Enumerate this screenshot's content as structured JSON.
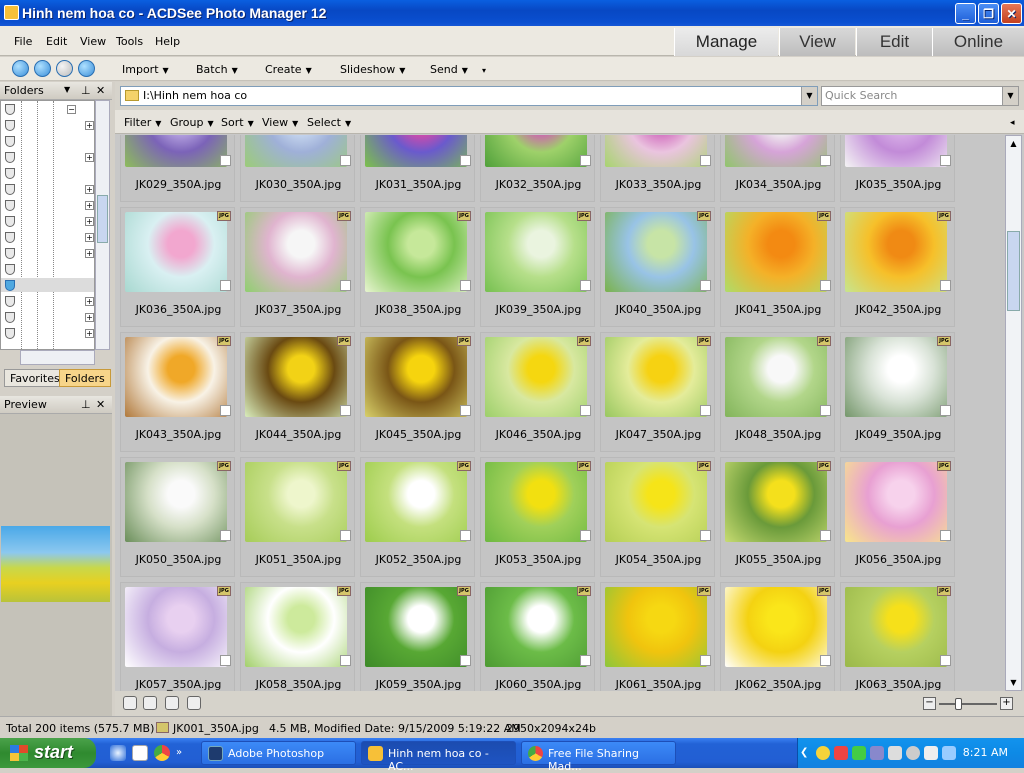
{
  "window": {
    "title": "Hinh nem hoa co - ACDSee Photo Manager 12"
  },
  "menus": [
    "File",
    "Edit",
    "View",
    "Tools",
    "Help"
  ],
  "mode_tabs": [
    "Manage",
    "View",
    "Edit",
    "Online"
  ],
  "toolbar": [
    "Import",
    "Batch",
    "Create",
    "Slideshow",
    "Send"
  ],
  "left_panel": {
    "folders_title": "Folders",
    "favorites_tab": "Favorites",
    "folders_tab": "Folders",
    "preview_title": "Preview"
  },
  "address": {
    "path": "I:\\Hinh nem hoa co",
    "search_placeholder": "Quick Search"
  },
  "filterbar": [
    "Filter",
    "Group",
    "Sort",
    "View",
    "Select"
  ],
  "thumbnails": [
    {
      "name": "JK029_350A.jpg",
      "colors": [
        "#b9a6e3",
        "#7b63b8",
        "#8dbd5a"
      ]
    },
    {
      "name": "JK030_350A.jpg",
      "colors": [
        "#c8d8f0",
        "#9fb0d8",
        "#9ccc78"
      ]
    },
    {
      "name": "JK031_350A.jpg",
      "colors": [
        "#d84aa8",
        "#6a5acd",
        "#7cc24a"
      ]
    },
    {
      "name": "JK032_350A.jpg",
      "colors": [
        "#cf5fb3",
        "#9ed16a",
        "#4fa03a"
      ]
    },
    {
      "name": "JK033_350A.jpg",
      "colors": [
        "#d26fbf",
        "#eac4df",
        "#a7d46e"
      ]
    },
    {
      "name": "JK034_350A.jpg",
      "colors": [
        "#f2f2f2",
        "#d6a4d8",
        "#90c56b"
      ]
    },
    {
      "name": "JK035_350A.jpg",
      "colors": [
        "#d9b0e8",
        "#c28bd8",
        "#f4f4f4"
      ]
    },
    {
      "name": "JK036_350A.jpg",
      "colors": [
        "#f2a7cf",
        "#d9f0f2",
        "#a8d8d0"
      ]
    },
    {
      "name": "JK037_350A.jpg",
      "colors": [
        "#f6f6f6",
        "#e0b4cf",
        "#8fcf6e"
      ]
    },
    {
      "name": "JK038_350A.jpg",
      "colors": [
        "#c6e89a",
        "#79c34f",
        "#e8f5d0"
      ]
    },
    {
      "name": "JK039_350A.jpg",
      "colors": [
        "#eaf4df",
        "#b6df8a",
        "#76c050"
      ]
    },
    {
      "name": "JK040_350A.jpg",
      "colors": [
        "#c7e4a6",
        "#98c3e6",
        "#7ab24c"
      ]
    },
    {
      "name": "JK041_350A.jpg",
      "colors": [
        "#f38a12",
        "#f4b128",
        "#aedc6a"
      ]
    },
    {
      "name": "JK042_350A.jpg",
      "colors": [
        "#f08a14",
        "#f6c02a",
        "#c7e58e"
      ]
    },
    {
      "name": "JK043_350A.jpg",
      "colors": [
        "#f0a828",
        "#f8f2e6",
        "#b0783a"
      ]
    },
    {
      "name": "JK044_350A.jpg",
      "colors": [
        "#f2d216",
        "#6a4a12",
        "#d9eebe"
      ]
    },
    {
      "name": "JK045_350A.jpg",
      "colors": [
        "#f6d40e",
        "#7a5616",
        "#d8d06a"
      ]
    },
    {
      "name": "JK046_350A.jpg",
      "colors": [
        "#f5d710",
        "#d8e8a0",
        "#9ccf6a"
      ]
    },
    {
      "name": "JK047_350A.jpg",
      "colors": [
        "#f6d212",
        "#e4ec9a",
        "#98c760"
      ]
    },
    {
      "name": "JK048_350A.jpg",
      "colors": [
        "#f8f8f8",
        "#b2d68a",
        "#82b45a"
      ]
    },
    {
      "name": "JK049_350A.jpg",
      "colors": [
        "#ffffff",
        "#d8e2d6",
        "#74966a"
      ]
    },
    {
      "name": "JK050_350A.jpg",
      "colors": [
        "#fafafa",
        "#d6e0c8",
        "#6a8e5a"
      ]
    },
    {
      "name": "JK051_350A.jpg",
      "colors": [
        "#eef6cc",
        "#c8e08a",
        "#a6cc58"
      ]
    },
    {
      "name": "JK052_350A.jpg",
      "colors": [
        "#ffffff",
        "#c4e07e",
        "#9dcc4c"
      ]
    },
    {
      "name": "JK053_350A.jpg",
      "colors": [
        "#f2e010",
        "#a0d05a",
        "#6cb840"
      ]
    },
    {
      "name": "JK054_350A.jpg",
      "colors": [
        "#f6e418",
        "#d6e474",
        "#b4ce54"
      ]
    },
    {
      "name": "JK055_350A.jpg",
      "colors": [
        "#f4e01c",
        "#6a9a3a",
        "#c8dc72"
      ]
    },
    {
      "name": "JK056_350A.jpg",
      "colors": [
        "#f7d2ec",
        "#e8a0d2",
        "#f8e68a"
      ]
    },
    {
      "name": "JK057_350A.jpg",
      "colors": [
        "#e8d0f0",
        "#c6aee0",
        "#ffffff"
      ]
    },
    {
      "name": "JK058_350A.jpg",
      "colors": [
        "#cdea9c",
        "#ffffff",
        "#a2d06a"
      ]
    },
    {
      "name": "JK059_350A.jpg",
      "colors": [
        "#ffffff",
        "#58a834",
        "#3d8a28"
      ]
    },
    {
      "name": "JK060_350A.jpg",
      "colors": [
        "#ffffff",
        "#6cbc48",
        "#4c9a32"
      ]
    },
    {
      "name": "JK061_350A.jpg",
      "colors": [
        "#f6d812",
        "#f0c40e",
        "#8cc63c"
      ]
    },
    {
      "name": "JK062_350A.jpg",
      "colors": [
        "#fae61a",
        "#f4d212",
        "#ffffff"
      ]
    },
    {
      "name": "JK063_350A.jpg",
      "colors": [
        "#f6e01a",
        "#b6d060",
        "#9ab84a"
      ]
    }
  ],
  "status": {
    "total": "Total 200 items  (575.7 MB)",
    "file": "JK001_350A.jpg",
    "info": "4.5 MB, Modified Date: 9/15/2009 5:19:22 AM",
    "dims": "2950x2094x24b"
  },
  "taskbar": {
    "start": "start",
    "tasks": [
      "Adobe Photoshop",
      "Hinh nem hoa co - AC...",
      "Free File Sharing Mad..."
    ],
    "clock": "8:21 AM"
  },
  "colors": {
    "title_blue": "#0a4fd0",
    "taskbar_blue": "#2262d6",
    "start_green": "#3c983c",
    "grid_bg": "#c6c6c6"
  }
}
